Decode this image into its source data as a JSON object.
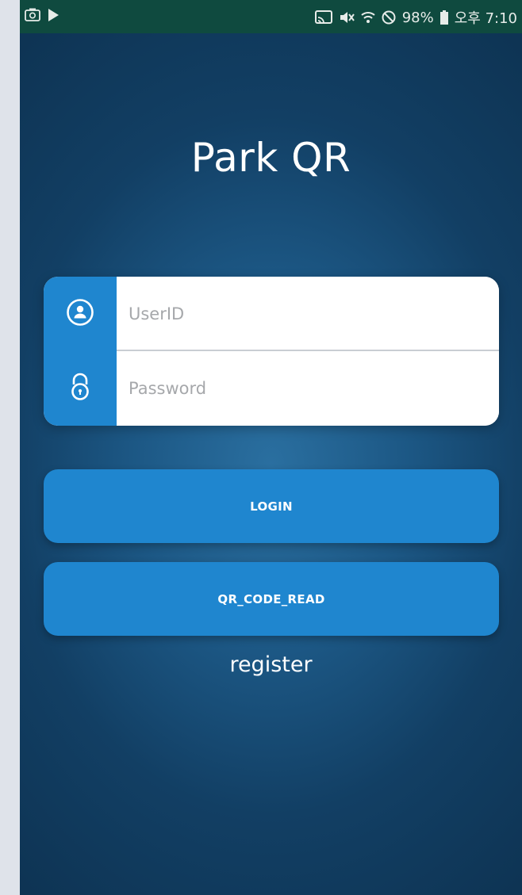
{
  "status_bar": {
    "battery": "98%",
    "time": "오후 7:10"
  },
  "app": {
    "title": "Park QR"
  },
  "login_form": {
    "userid_placeholder": "UserID",
    "password_placeholder": "Password"
  },
  "buttons": {
    "login_label": "LOGIN",
    "qr_label": "QR_CODE_READ"
  },
  "register_label": "register",
  "icons": {
    "user": "user-circle-icon",
    "lock": "padlock-icon"
  },
  "colors": {
    "accent": "#1f86cf",
    "background": "#1c5784",
    "status_bar": "#0f4a3f"
  }
}
